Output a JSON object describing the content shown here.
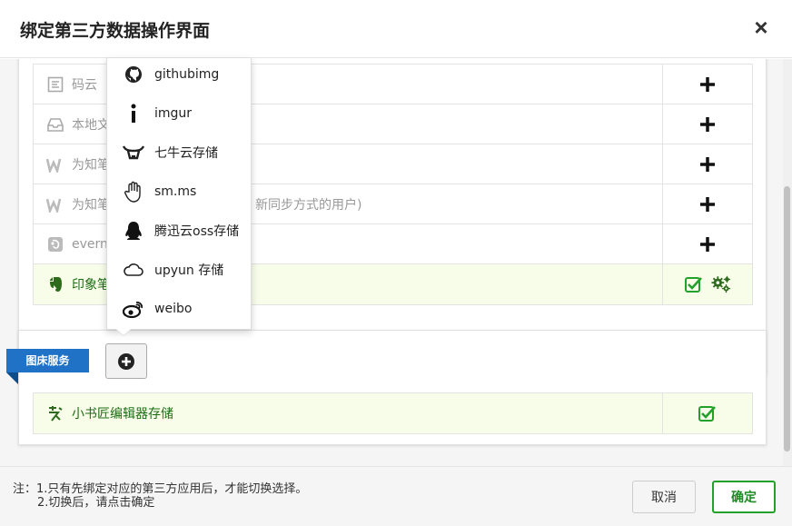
{
  "dialog": {
    "title": "绑定第三方数据操作界面",
    "close_glyph": "×"
  },
  "storage_rows": [
    {
      "label": "码云",
      "icon": "gitee-icon",
      "state": "add"
    },
    {
      "label": "本地文",
      "icon": "inbox-icon",
      "state": "add"
    },
    {
      "label": "为知笔",
      "icon": "wiz-icon",
      "state": "add"
    },
    {
      "label": "为知笔",
      "suffix": "新同步方式的用户)",
      "icon": "wiz-icon",
      "state": "add"
    },
    {
      "label": "everno",
      "icon": "evernote-icon",
      "state": "add"
    },
    {
      "label": "印象笔",
      "icon": "yinxiang-icon",
      "state": "bound"
    }
  ],
  "image_service": {
    "tag_label": "图床服务",
    "rows": [
      {
        "label": "小书匠编辑器存储",
        "icon": "xiaoshujiang-icon",
        "state": "bound"
      }
    ]
  },
  "dropdown": {
    "items": [
      {
        "label": "githubimg",
        "icon": "github-icon"
      },
      {
        "label": "imgur",
        "icon": "info-i-icon"
      },
      {
        "label": "七牛云存储",
        "icon": "qiniu-icon"
      },
      {
        "label": "sm.ms",
        "icon": "hand-icon"
      },
      {
        "label": "腾迅云oss存储",
        "icon": "qq-penguin-icon"
      },
      {
        "label": "upyun 存储",
        "icon": "cloud-icon"
      },
      {
        "label": "weibo",
        "icon": "weibo-icon"
      }
    ]
  },
  "footer": {
    "note_line1": "注：1.只有先绑定对应的第三方应用后，才能切换选择。",
    "note_line2": "2.切换后，请点击确定",
    "cancel_label": "取消",
    "ok_label": "确定"
  },
  "colors": {
    "accent_green": "#22a22a",
    "tag_blue": "#1f72c5",
    "active_row_bg": "#f8fdea"
  }
}
